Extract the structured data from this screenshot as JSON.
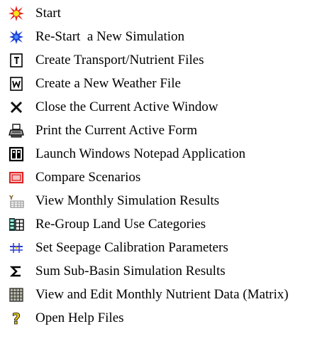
{
  "menu": {
    "items": [
      {
        "label": "Start",
        "icon": "start-burst-icon"
      },
      {
        "label": "Re-Start  a New Simulation",
        "icon": "restart-burst-icon"
      },
      {
        "label": "Create Transport/Nutrient Files",
        "icon": "transport-file-icon"
      },
      {
        "label": "Create a New Weather File",
        "icon": "weather-file-icon"
      },
      {
        "label": "Close the Current Active Window",
        "icon": "close-x-icon"
      },
      {
        "label": "Print the Current Active Form",
        "icon": "printer-icon"
      },
      {
        "label": "Launch Windows Notepad Application",
        "icon": "notepad-icon"
      },
      {
        "label": "Compare Scenarios",
        "icon": "compare-scenarios-icon"
      },
      {
        "label": "View Monthly Simulation Results",
        "icon": "monthly-results-icon"
      },
      {
        "label": "Re-Group Land Use Categories",
        "icon": "regroup-landuse-icon"
      },
      {
        "label": "Set Seepage Calibration Parameters",
        "icon": "seepage-calibration-icon"
      },
      {
        "label": "Sum Sub-Basin Simulation Results",
        "icon": "sigma-sum-icon"
      },
      {
        "label": "View and Edit Monthly Nutrient Data (Matrix)",
        "icon": "matrix-grid-icon"
      },
      {
        "label": "Open Help Files",
        "icon": "help-question-icon"
      }
    ]
  },
  "colors": {
    "start_burst": "#e8201a",
    "start_core": "#f7e51c",
    "restart_burst": "#1a3fd6",
    "close_x": "#111111",
    "compare_red": "#e02020",
    "seepage_blue": "#2a3fcf",
    "help_yellow": "#e8c81a"
  }
}
